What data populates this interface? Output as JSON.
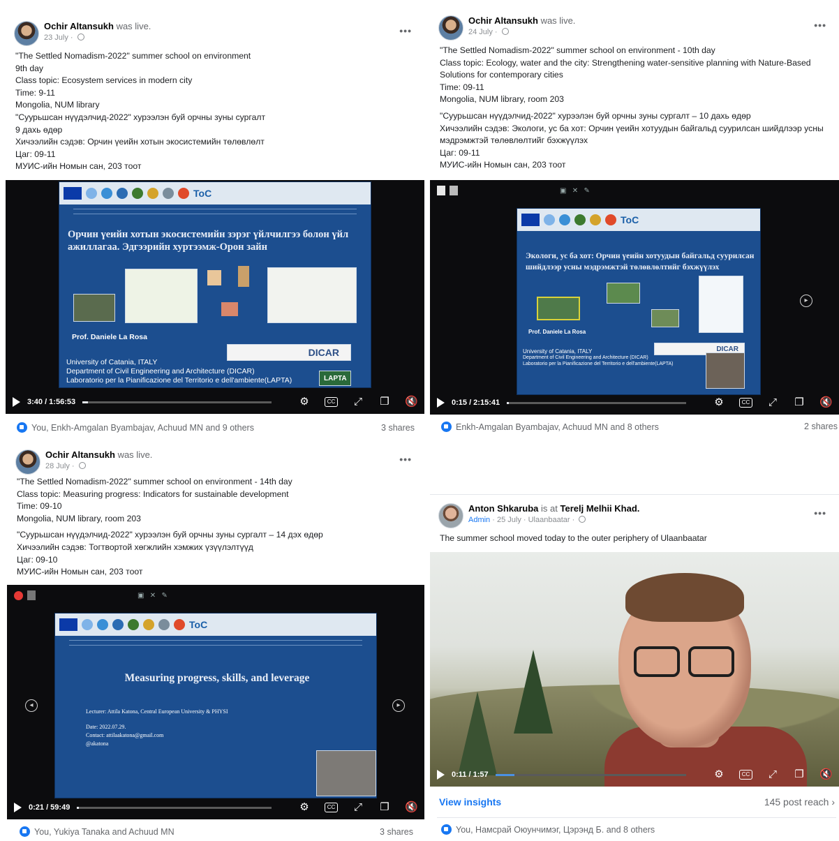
{
  "posts": [
    {
      "author": "Ochir Altansukh",
      "action": "was live.",
      "date": "23 July",
      "lines": [
        "\"The Settled Nomadism-2022\" summer school on environment",
        "9th day",
        "Class topic: Ecosystem services in modern city",
        "Time: 9-11",
        "Mongolia, NUM library",
        "\"Суурьшсан нүүдэлчид-2022\" хурээлэн буй орчны зуны сургалт",
        "9 дахь өдөр",
        "Хичээлийн сэдэв: Орчин үеийн хотын экосистемийн төлөвлөлт",
        "Цаг: 09-11",
        "МУИС-ийн Номын сан, 203 тоот"
      ],
      "slide": {
        "title": "Орчин үеийн хотын экосистемийн зэрэг үйлчилгээ болон үйл ажиллагаа. Эдгээрийн хуртээмж-Орон зайн",
        "presenter": "Prof. Daniele La Rosa",
        "org1": "University of Catania, ITALY",
        "org2": "Department of Civil Engineering and Architecture (DICAR)",
        "org3": "Laboratorio per la Pianificazione del Territorio e dell'ambiente(LAPTA)",
        "dicar": "DICAR",
        "lapta": "LAPTA",
        "toc": "ToC"
      },
      "video_time": "3:40 / 1:56:53",
      "video_progress": 0.03,
      "reactions": "You, Enkh-Amgalan Byambajav, Achuud MN and 9 others",
      "shares": "3 shares"
    },
    {
      "author": "Ochir Altansukh",
      "action": "was live.",
      "date": "24 July",
      "lines": [
        "\"The Settled Nomadism-2022\" summer school on environment - 10th day",
        "Class topic: Ecology, water and the city: Strengthening water-sensitive planning with Nature-Based Solutions for contemporary cities",
        "Time: 09-11",
        "Mongolia, NUM library, room 203",
        "",
        "\"Суурьшсан нүүдэлчид-2022\" хурээлэн буй орчны зуны сургалт – 10 дахь өдөр",
        "Хичээлийн сэдэв: Экологи, ус ба хот: Орчин үеийн хотуудын байгальд суурилсан шийдлээр усны мэдрэмжтэй төлөвлөлтийг бэхжүүлэх",
        "Цаг: 09-11",
        "МУИС-ийн Номын сан, 203 тоот"
      ],
      "slide": {
        "title": "Экологи, ус ба хот: Орчин үеийн хотуудын байгальд суурилсан шийдлээр усны мэдрэмжтэй төлөвлөлтийг бэхжүүлэх",
        "presenter": "Prof. Daniele La Rosa",
        "org1": "University of Catania, ITALY",
        "org2": "Department of Civil Engineering and Architecture (DICAR)",
        "org3": "Laboratorio per la Pianificazione del Territorio e dell'ambiente(LAPTA)",
        "dicar": "DICAR",
        "toc": "ToC"
      },
      "video_time": "0:15 / 2:15:41",
      "video_progress": 0.01,
      "reactions": "Enkh-Amgalan Byambajav, Achuud MN and 8 others",
      "shares": "2 shares"
    },
    {
      "author": "Ochir Altansukh",
      "action": "was live.",
      "date": "28 July",
      "lines": [
        "\"The Settled Nomadism-2022\" summer school on environment - 14th day",
        "Class topic: Measuring progress: Indicators for sustainable development",
        "Time: 09-10",
        "Mongolia, NUM library, room 203",
        "",
        "\"Суурьшсан нүүдэлчид-2022\" хурээлэн буй орчны зуны сургалт – 14 дэх өдөр",
        "Хичээлийн сэдэв: Тогтвортой хөгжлийн хэмжих үзүүлэлтүүд",
        "Цаг: 09-10",
        "МУИС-ийн Номын сан, 203 тоот"
      ],
      "slide": {
        "title": "Measuring progress, skills, and leverage",
        "lecturer": "Lecturer: Attila Katona, Central European University & PHYSI",
        "date": "Date: 2022.07.29.",
        "contact": "Contact: attilaakatona@gmail.com",
        "handle": "@akatona",
        "toc": "ToC"
      },
      "video_time": "0:21 / 59:49",
      "video_progress": 0.01,
      "reactions": "You, Yukiya Tanaka and Achuud MN",
      "shares": "3 shares"
    },
    {
      "author": "Anton Shkaruba",
      "action_prefix": "is at",
      "place": "Terelj Melhii Khad.",
      "role": "Admin",
      "date": "25 July",
      "location": "Ulaanbaatar",
      "text": "The summer school moved today to the outer periphery of Ulaanbaatar",
      "video_time": "0:11 / 1:57",
      "video_progress": 0.1,
      "insights_label": "View insights",
      "reach": "145 post reach",
      "reactions": "You, Намсрай Оюунчимэг, Цэрэнд Б. and 8 others"
    }
  ],
  "icons": {
    "more": "more-dots-icon",
    "privacy": "globe-icon",
    "settings": "gear-icon",
    "captions": "cc-icon",
    "fullscreen": "expand-icon",
    "pip": "pip-icon",
    "volume": "mute-icon",
    "like": "like-icon"
  },
  "colors": {
    "link": "#1877f2",
    "slide_blue": "#1c4e8f",
    "video_bg": "#0c0c0e"
  }
}
